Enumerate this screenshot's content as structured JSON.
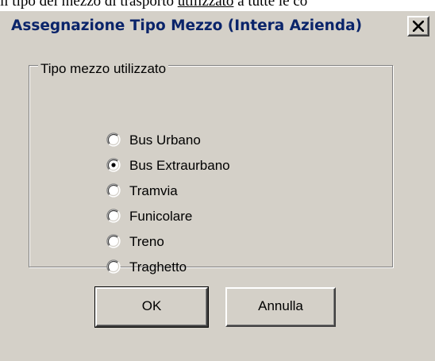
{
  "background": {
    "text_before": "il tipo del mezzo di trasporto ",
    "text_underlined": "utilizzato",
    "text_after": " a tutte le co"
  },
  "dialog": {
    "title": "Assegnazione Tipo Mezzo (Intera Azienda)",
    "group_label": "Tipo mezzo utilizzato",
    "options": [
      {
        "label": "Bus Urbano",
        "selected": false
      },
      {
        "label": "Bus Extraurbano",
        "selected": true
      },
      {
        "label": "Tramvia",
        "selected": false
      },
      {
        "label": "Funicolare",
        "selected": false
      },
      {
        "label": "Treno",
        "selected": false
      },
      {
        "label": "Traghetto",
        "selected": false
      }
    ],
    "ok_label": "OK",
    "cancel_label": "Annulla"
  },
  "colors": {
    "face": "#d4d0c8",
    "title_text": "#0a246a"
  }
}
